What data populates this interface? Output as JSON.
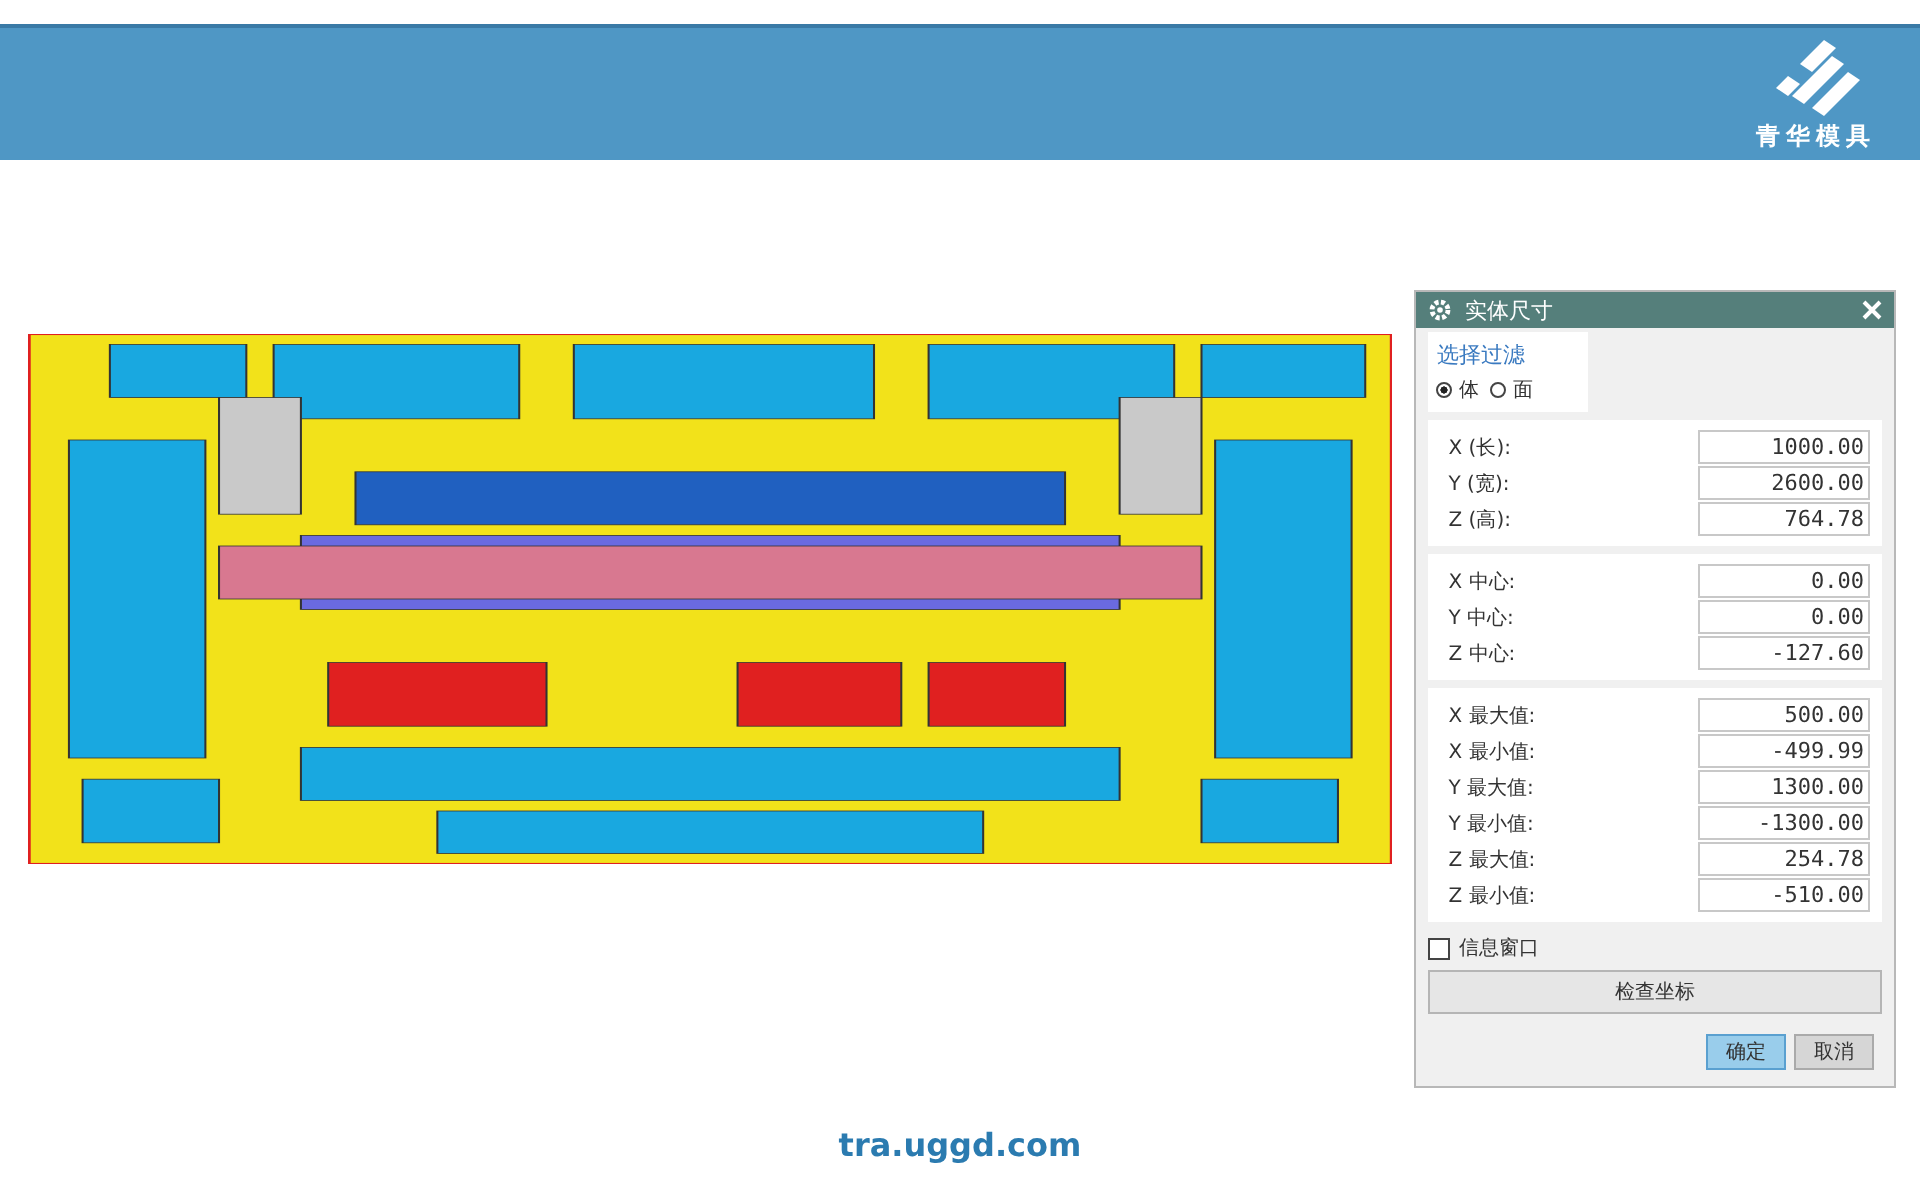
{
  "header": {
    "logo_text": "青华模具"
  },
  "dialog": {
    "title": "实体尺寸",
    "filter_label": "选择过滤",
    "filter_options": [
      {
        "label": "体",
        "selected": true
      },
      {
        "label": "面",
        "selected": false
      }
    ],
    "groups": [
      [
        {
          "label": "X (长):",
          "value": "1000.00"
        },
        {
          "label": "Y (宽):",
          "value": "2600.00"
        },
        {
          "label": "Z (高):",
          "value": "764.78"
        }
      ],
      [
        {
          "label": "X 中心:",
          "value": "0.00"
        },
        {
          "label": "Y 中心:",
          "value": "0.00"
        },
        {
          "label": "Z 中心:",
          "value": "-127.60"
        }
      ],
      [
        {
          "label": "X 最大值:",
          "value": "500.00"
        },
        {
          "label": "X 最小值:",
          "value": "-499.99"
        },
        {
          "label": "Y 最大值:",
          "value": "1300.00"
        },
        {
          "label": "Y 最小值:",
          "value": "-1300.00"
        },
        {
          "label": "Z 最大值:",
          "value": "254.78"
        },
        {
          "label": "Z 最小值:",
          "value": "-510.00"
        }
      ]
    ],
    "info_window": {
      "label": "信息窗口",
      "checked": false
    },
    "check_button": "检查坐标",
    "buttons": [
      {
        "label": "确定",
        "primary": true
      },
      {
        "label": "取消",
        "primary": false
      }
    ]
  },
  "footer": "tra.uggd.com"
}
